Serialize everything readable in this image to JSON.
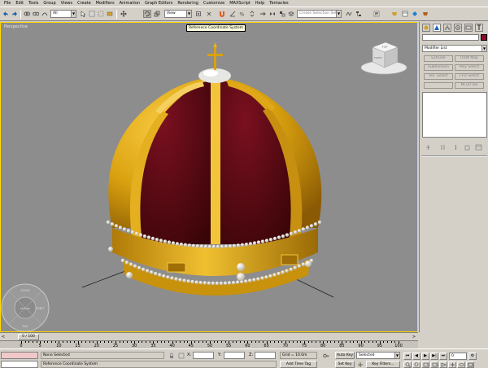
{
  "menu": [
    "File",
    "Edit",
    "Tools",
    "Group",
    "Views",
    "Create",
    "Modifiers",
    "Animation",
    "Graph Editors",
    "Rendering",
    "Customize",
    "MAXScript",
    "Help",
    "Tentacles"
  ],
  "toolbar": {
    "filter_value": "All",
    "coord_value": "View",
    "selection_set_placeholder": "Create Selection Set",
    "tooltip": "Reference Coordinate System"
  },
  "viewport": {
    "label": "Perspective",
    "viewcube_top": "TOP",
    "viewcube_front": "FRONT",
    "wheel_labels": [
      "ZOOM",
      "ORBIT",
      "PAN",
      "REWIND"
    ]
  },
  "command_panel": {
    "modifier_list": "Modifier List",
    "buttons": [
      "Extrude",
      "UVW Map",
      "Subdivision",
      "Poly Select",
      "Vol. Select",
      "FFD Select",
      "",
      "NCurl Sel"
    ]
  },
  "timeline": {
    "frame_display": "0 / 100",
    "ticks": [
      "0",
      "5",
      "10",
      "15",
      "20",
      "25",
      "30",
      "35",
      "40",
      "45",
      "50",
      "55",
      "60",
      "65",
      "70",
      "75",
      "80",
      "85",
      "90",
      "95",
      "100"
    ]
  },
  "status": {
    "selection": "None Selected",
    "prompt": "Reference Coordinate System",
    "x_label": "X:",
    "y_label": "Y:",
    "z_label": "Z:",
    "x_value": "",
    "y_value": "",
    "z_value": "",
    "grid": "Grid = 10.0m",
    "add_time_tag": "Add Time Tag",
    "auto_key": "Auto Key",
    "set_key": "Set Key",
    "key_mode": "Selected",
    "key_filters": "Key Filters...",
    "frame_value": "0"
  },
  "colors": {
    "viewport_bg": "#8d8d8d",
    "viewport_border": "#ffd700",
    "gold": "#d9a10f",
    "velvet": "#5a0a12",
    "pearl": "#e8e2cc"
  }
}
